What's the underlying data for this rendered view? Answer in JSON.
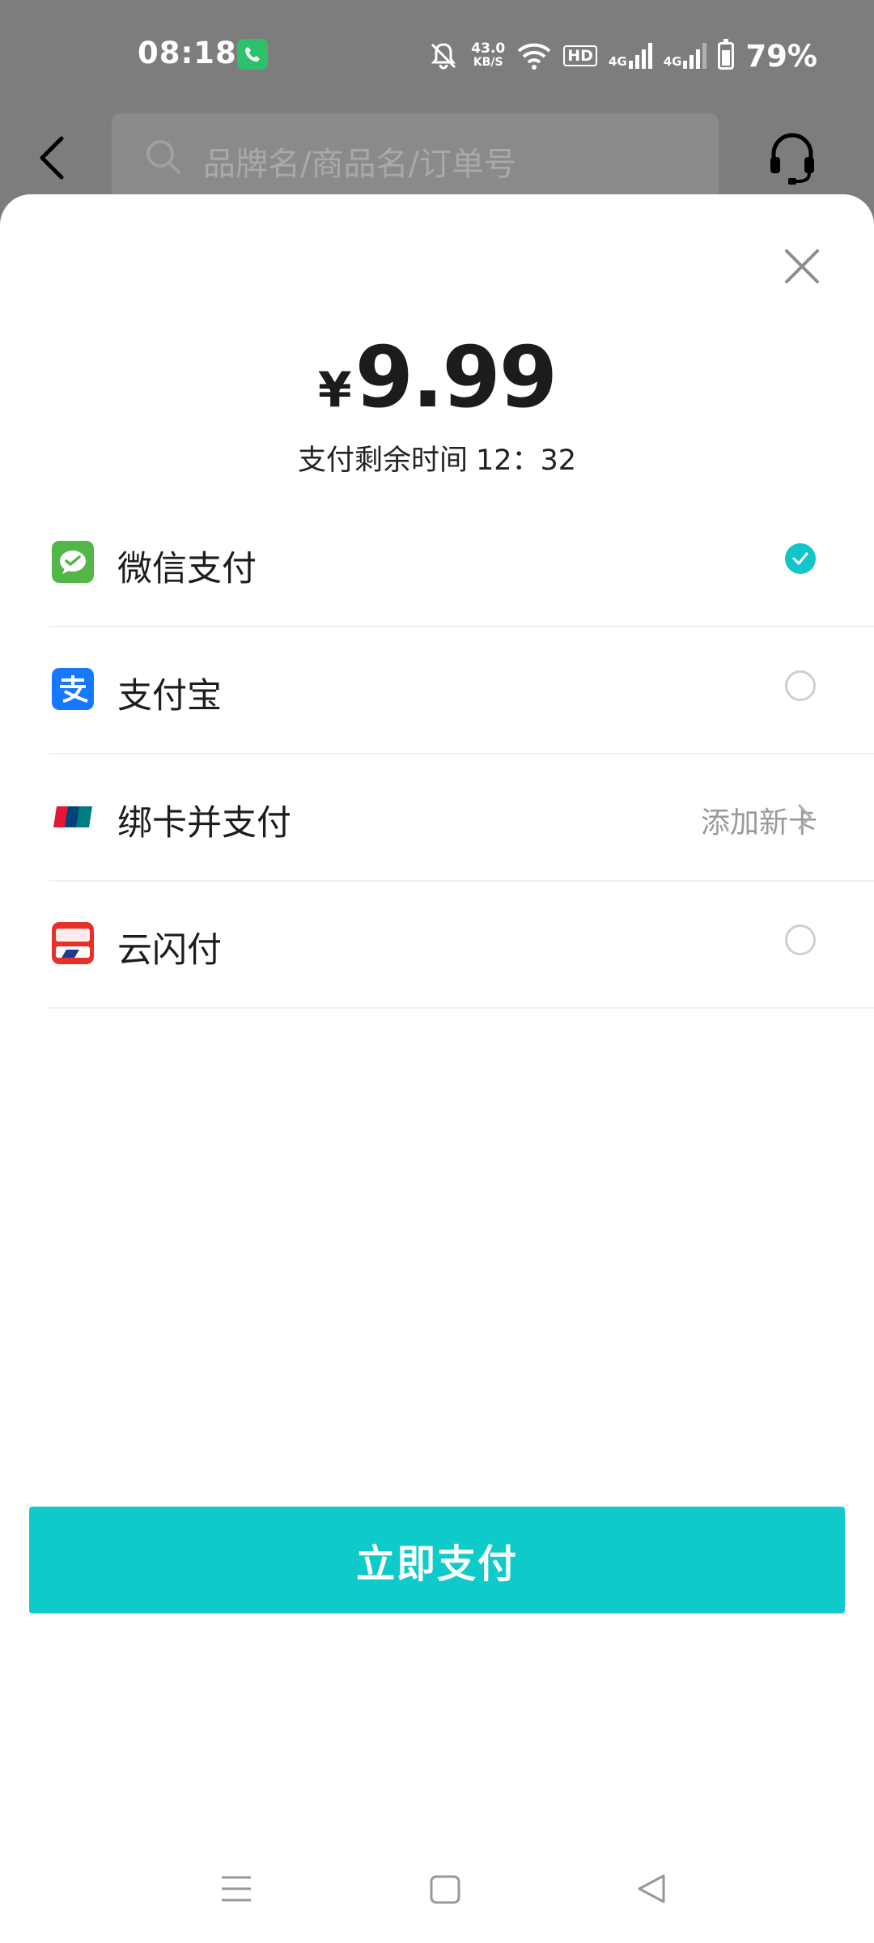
{
  "status_bar": {
    "time": "08:18",
    "net_speed_value": "43.0",
    "net_speed_unit": "KB/S",
    "hd_label": "HD",
    "net1": "4G",
    "net2": "4G",
    "battery_percent_text": "79%",
    "battery_level": 0.79,
    "icons": [
      "phone-call-icon",
      "mute-icon",
      "wifi-icon",
      "signal-icon",
      "battery-icon"
    ]
  },
  "topbar": {
    "search_placeholder": "品牌名/商品名/订单号"
  },
  "sheet": {
    "currency_symbol": "¥",
    "amount": "9.99",
    "countdown_label": "支付剩余时间",
    "countdown_time": "12：32",
    "methods": [
      {
        "label": "微信支付",
        "selected": true
      },
      {
        "label": "支付宝",
        "selected": false
      },
      {
        "label": "绑卡并支付",
        "action": "添加新卡"
      },
      {
        "label": "云闪付",
        "selected": false
      }
    ],
    "pay_button": "立即支付"
  },
  "colors": {
    "accent": "#0fcaca",
    "wechat": "#53b748",
    "alipay": "#1677ff",
    "unionpay_red": "#e21836",
    "dim_overlay": "#7d7d7d"
  }
}
